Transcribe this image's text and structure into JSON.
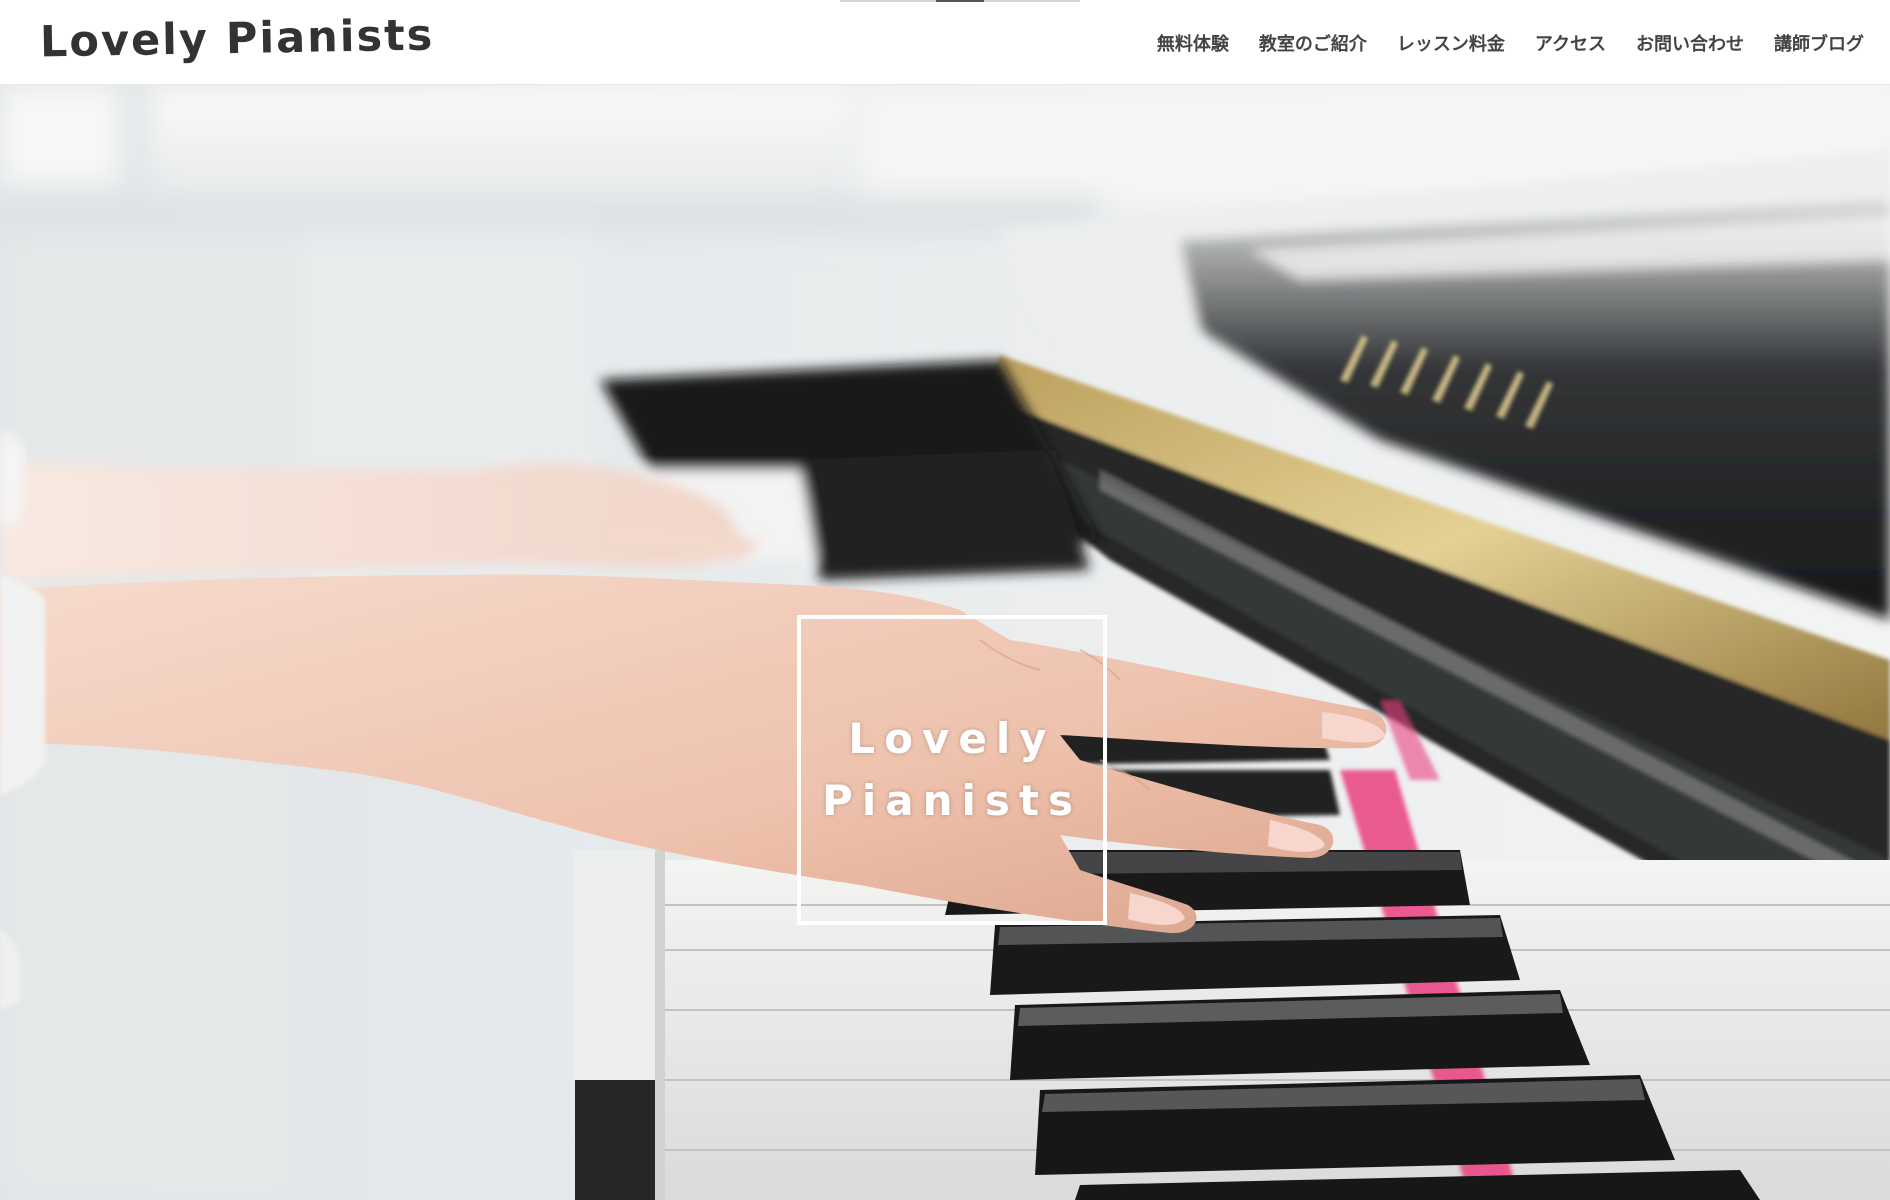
{
  "site": {
    "logo_text": "Lovely Pianists"
  },
  "nav": {
    "items": [
      {
        "label": "無料体験"
      },
      {
        "label": "教室のご紹介"
      },
      {
        "label": "レッスン料金"
      },
      {
        "label": "アクセス"
      },
      {
        "label": "お問い合わせ"
      },
      {
        "label": "講師ブログ"
      }
    ]
  },
  "hero": {
    "image": "hands playing piano keys",
    "badge_line1": "Lovely",
    "badge_line2": "Pianists"
  },
  "colors": {
    "header_bg": "#ffffff",
    "text_dark": "#333333",
    "badge_border": "#ffffff",
    "felt_accent": "#e8357a"
  }
}
